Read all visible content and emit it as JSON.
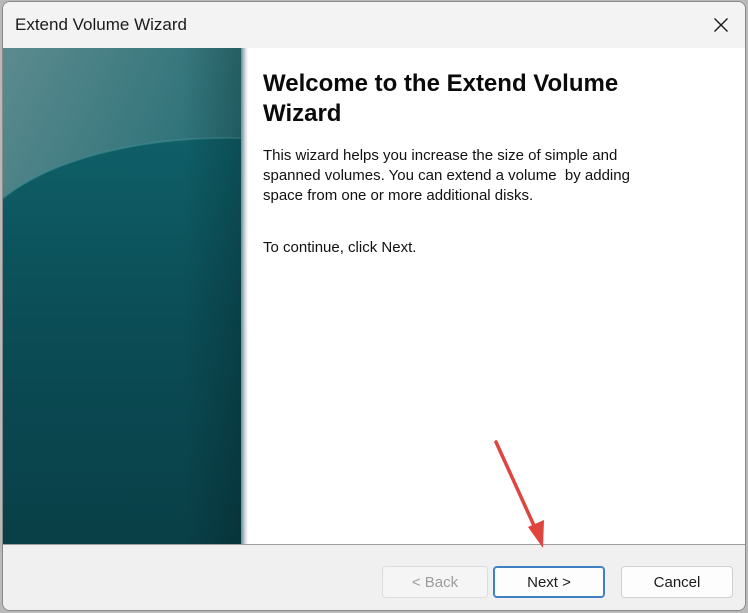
{
  "window": {
    "title": "Extend Volume Wizard"
  },
  "wizard": {
    "heading": "Welcome to the Extend Volume Wizard",
    "description": "This wizard helps you increase the size of simple and spanned volumes. You can extend a volume  by adding space from one or more additional disks.",
    "continue_text": "To continue, click Next."
  },
  "buttons": {
    "back": "< Back",
    "next": "Next >",
    "cancel": "Cancel"
  },
  "state": {
    "back_enabled": false
  },
  "colors": {
    "banner": "#0d4b56",
    "annotation_arrow": "#e0443e",
    "focus_border": "#3f7fc4"
  },
  "icons": {
    "close": "close-icon"
  }
}
